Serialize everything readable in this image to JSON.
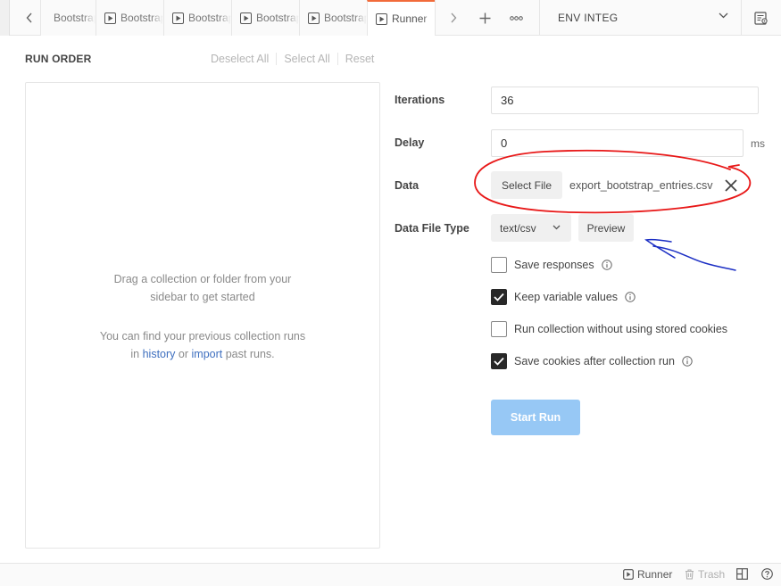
{
  "tabs": [
    {
      "label": "Bootstrap"
    },
    {
      "label": "Bootstrap"
    },
    {
      "label": "Bootstrap"
    },
    {
      "label": "Bootstrap"
    },
    {
      "label": "Bootstrap"
    },
    {
      "label": "Runner"
    }
  ],
  "header": {
    "more_label": "∘∘∘",
    "environment": "ENV INTEG"
  },
  "run_order": {
    "title": "RUN ORDER",
    "deselect_all": "Deselect All",
    "select_all": "Select All",
    "reset": "Reset",
    "empty_line1": "Drag a collection or folder from your",
    "empty_line2": "sidebar to get started",
    "history_line1": "You can find your previous collection runs",
    "history_prefix": "in",
    "history_link": "history",
    "history_mid": "or",
    "import_link": "import",
    "history_suffix": "past runs."
  },
  "settings": {
    "iterations_label": "Iterations",
    "iterations_value": "36",
    "delay_label": "Delay",
    "delay_value": "0",
    "delay_unit": "ms",
    "data_label": "Data",
    "select_file_label": "Select File",
    "file_name": "export_bootstrap_entries.csv",
    "data_file_type_label": "Data File Type",
    "data_file_type_value": "text/csv",
    "preview_label": "Preview",
    "options": [
      {
        "label": "Save responses",
        "checked": false,
        "info": true
      },
      {
        "label": "Keep variable values",
        "checked": true,
        "info": true
      },
      {
        "label": "Run collection without using stored cookies",
        "checked": false,
        "info": false
      },
      {
        "label": "Save cookies after collection run",
        "checked": true,
        "info": true
      }
    ],
    "start_run_label": "Start Run"
  },
  "footer": {
    "runner_label": "Runner",
    "trash_label": "Trash"
  },
  "colors": {
    "active_tab_accent": "#f26b3a",
    "start_button": "#97c8f5",
    "link": "#3e6fbf",
    "annotation_red": "#e81818",
    "annotation_blue": "#1c2fc4"
  }
}
